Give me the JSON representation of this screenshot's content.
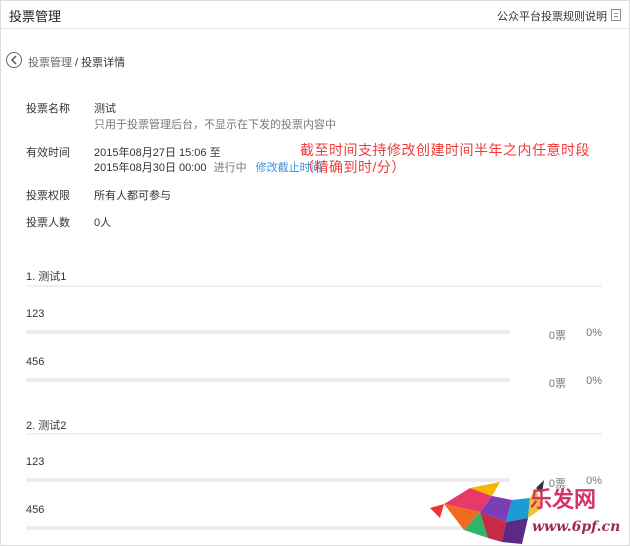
{
  "header": {
    "title": "投票管理",
    "help_link": "公众平台投票规则说明",
    "help_icon": "document-icon"
  },
  "breadcrumb": {
    "back_icon": "circle-chevron-left-icon",
    "parent": "投票管理",
    "separator": " / ",
    "current": "投票详情"
  },
  "details": {
    "name_label": "投票名称",
    "name_value": "测试",
    "name_hint": "只用于投票管理后台，不显示在下发的投票内容中",
    "period_label": "有效时间",
    "period_start": "2015年08月27日 15:06 至",
    "period_end": "2015年08月30日 00:00",
    "period_status": "进行中",
    "modify_link": "修改截止时间",
    "permission_label": "投票权限",
    "permission_value": "所有人都可参与",
    "count_label": "投票人数",
    "count_value": "0人"
  },
  "annotation": {
    "line1": "截至时间支持修改创建时间半年之内任意时段",
    "line2": "（精确到时/分）",
    "color": "#f03a3a"
  },
  "questions": [
    {
      "title": "1. 测试1",
      "options": [
        {
          "label": "123",
          "votes": "0票",
          "percent": "0%",
          "fraction": 0
        },
        {
          "label": "456",
          "votes": "0票",
          "percent": "0%",
          "fraction": 0
        }
      ]
    },
    {
      "title": "2. 测试2",
      "options": [
        {
          "label": "123",
          "votes": "0票",
          "percent": "0%",
          "fraction": 0
        },
        {
          "label": "456",
          "votes": "",
          "percent": "",
          "fraction": 0
        }
      ]
    }
  ],
  "watermark": {
    "brand": "乐发网",
    "url": "www.6pf.cn",
    "logo": "geometric-bull-logo"
  }
}
